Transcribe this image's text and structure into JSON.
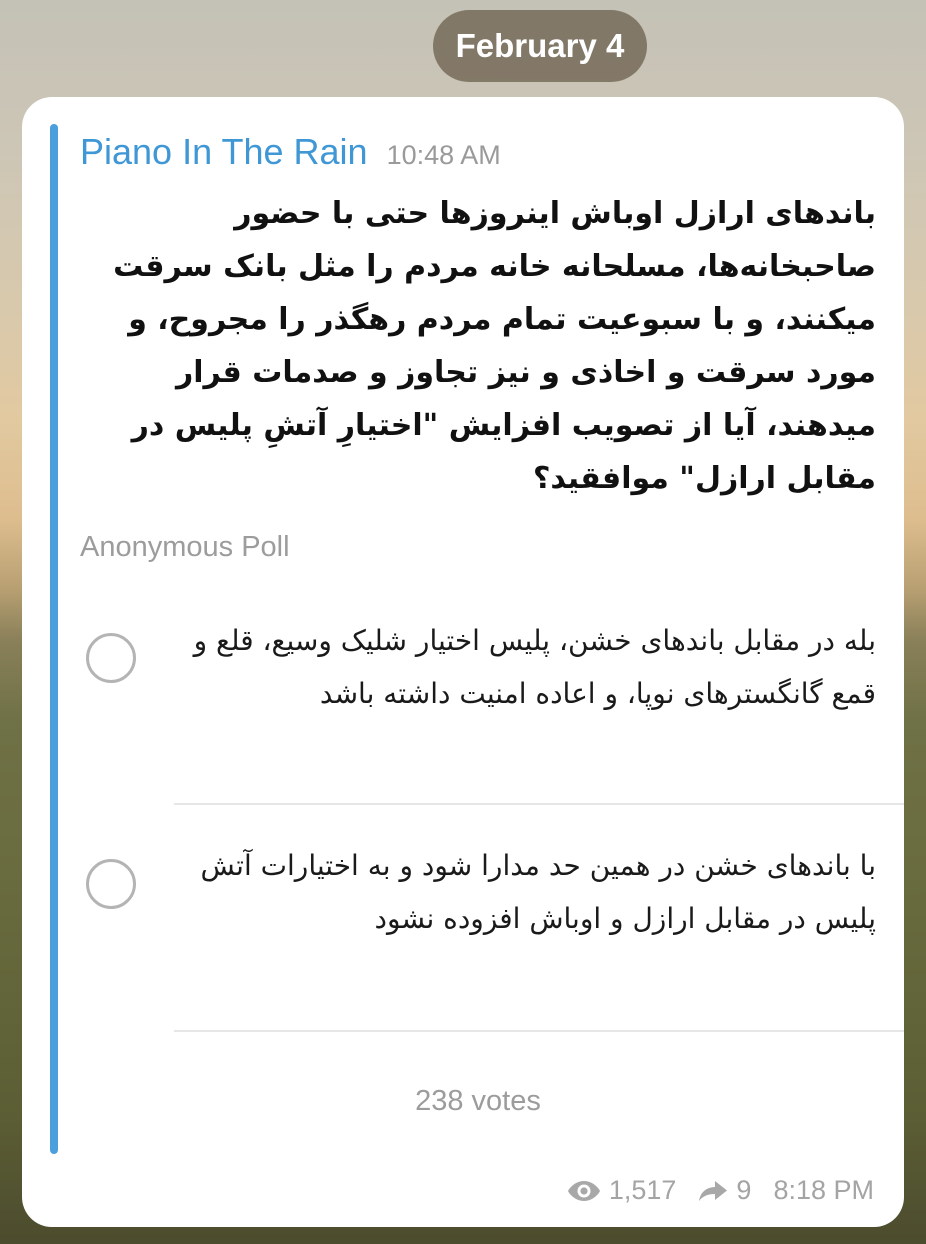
{
  "date_pill": "February 4",
  "message": {
    "author": "Piano In The Rain",
    "time": "10:48 AM",
    "question": "باندهای ارازل اوباش اینروزها حتی با حضور صاحبخانه‌ها، مسلحانه خانه مردم را مثل بانک سرقت میکنند، و با سبوعیت تمام مردم رهگذر را مجروح، و مورد سرقت و اخاذی و نیز تجاوز  و صدمات قرار میدهند، آیا از تصویب افزایش \"اختیارِ آتشِ پلیس در مقابل ارازل\" موافقید؟",
    "poll_type": "Anonymous Poll",
    "options": [
      {
        "text": "بله در مقابل باندهای خشن، پلیس اختیار شلیک وسیع، قلع و قمع گانگسترهای نوپا، و اعاده امنیت داشته باشد"
      },
      {
        "text": "با باندهای خشن در همین حد مدارا شود و به اختیارات آتش پلیس در مقابل ارازل و اوباش افزوده نشود"
      }
    ],
    "votes": "238 votes",
    "views": "1,517",
    "shares": "9",
    "post_time": "8:18 PM"
  },
  "icons": {
    "views": "eye-icon",
    "shares": "share-arrow-icon"
  },
  "colors": {
    "accent": "#3f97d5",
    "quote_bar": "#4a9fdc",
    "secondary_text": "#9c9c9c"
  }
}
